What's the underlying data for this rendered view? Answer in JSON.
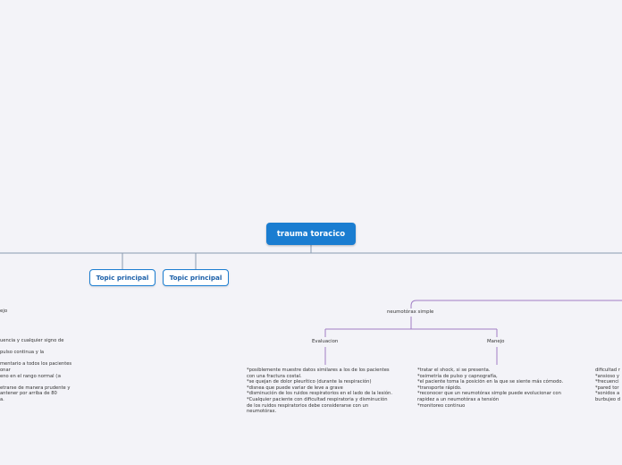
{
  "main_topic": "trauma toracico",
  "topics": [
    "Topic principal",
    "Topic principal"
  ],
  "branch": {
    "title": "neumotórax simple",
    "evaluacion": {
      "label": "Evaluacion",
      "text": "*posiblemente muestre datos similares a los de los pacientes\ncon una fractura costal.\n*se quejan de dolor pleurítico (durante la respiración)\n*disnea que puede variar de leve a grave\n*disminución de los ruidos respiratorios en el lado de la lesión.\n*Cualquier paciente con dificultad respiratoria y disminución\nde los ruidos respiratorios debe considerarse con un\nneumotórax."
    },
    "manejo": {
      "label": "Manejo",
      "text": "*tratar el shock, si se presenta.\n*oximetría de pulso y capnografía,\n*el paciente toma la posición en la que se siente más cómodo.\n*transporte rápido.\n*reconocer que un neumotórax simple puede evolucionar con\nrapidez a un neumotórax a tensión\n*monitoreo continuo"
    }
  },
  "left_partial": {
    "label": "ejo",
    "text": "uencia y cualquier signo de\n\npulso continua y la\n\nmentario a todos los pacientes\nonar\neno en el rango normal (≥\n\netrarse de manera prudente y\nantener por arriba de 80\na."
  },
  "right_partial": {
    "text": "dificultad r\n*ansioso y\n*frecuenci\n*pared tor\n*sonidos a\nburbujeo d"
  },
  "colors": {
    "background": "#f3f3f8",
    "main_topic_fill": "#1a7dd1",
    "topic_border": "#1a7dd1",
    "connector_blue": "#8a9bb0",
    "connector_purple": "#a07cc4"
  }
}
